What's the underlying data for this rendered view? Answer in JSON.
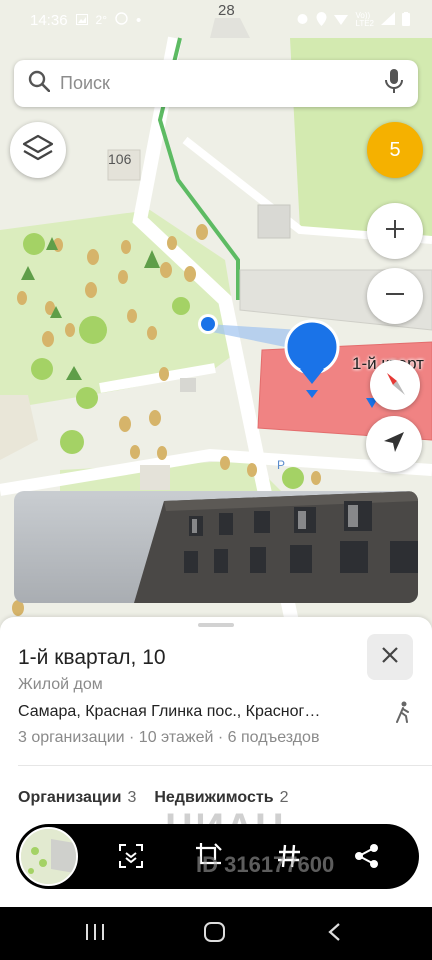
{
  "status": {
    "time": "14:36",
    "temperature": "2°",
    "signal_text": "Vo))\nLTE2",
    "icons": [
      "image-icon",
      "whatsapp-icon",
      "dot-icon",
      "alarm-icon",
      "location-icon",
      "wifi-icon",
      "signal-icon",
      "battery-icon"
    ]
  },
  "search": {
    "placeholder": "Поиск",
    "icons": [
      "search-icon",
      "microphone-icon"
    ]
  },
  "map": {
    "house_numbers": [
      "28",
      "106"
    ],
    "building_label": "1-й кварт",
    "parking_label": "P",
    "traffic_level": "5",
    "colors": {
      "park": "#d6ecb5",
      "road": "#ffffff",
      "building_highlight": "#f08383",
      "route": "#5dbb63",
      "pin": "#1a73e8",
      "accent": "#f5b100"
    }
  },
  "controls": {
    "layers_icon": "layers-icon",
    "zoom_in_icon": "plus-icon",
    "zoom_out_icon": "minus-icon",
    "compass_icon": "compass-icon",
    "locate_icon": "navigation-arrow-icon"
  },
  "place": {
    "title": "1-й квартал, 10",
    "type": "Жилой дом",
    "address": "Самара, Красная Глинка пос., Красног…",
    "details": "3 организации · 10 этажей · 6 подъездов",
    "tabs": [
      {
        "label": "Организации",
        "count": "3"
      },
      {
        "label": "Недвижимость",
        "count": "2"
      }
    ]
  },
  "watermark": {
    "brand": "ЦИАН",
    "id": "ID 316177600"
  },
  "toolbar": {
    "icons": [
      "scan-icon",
      "crop-edit-icon",
      "hashtag-icon",
      "share-icon"
    ]
  },
  "navbar": {
    "icons": [
      "recent-apps-icon",
      "home-icon",
      "back-icon"
    ]
  }
}
